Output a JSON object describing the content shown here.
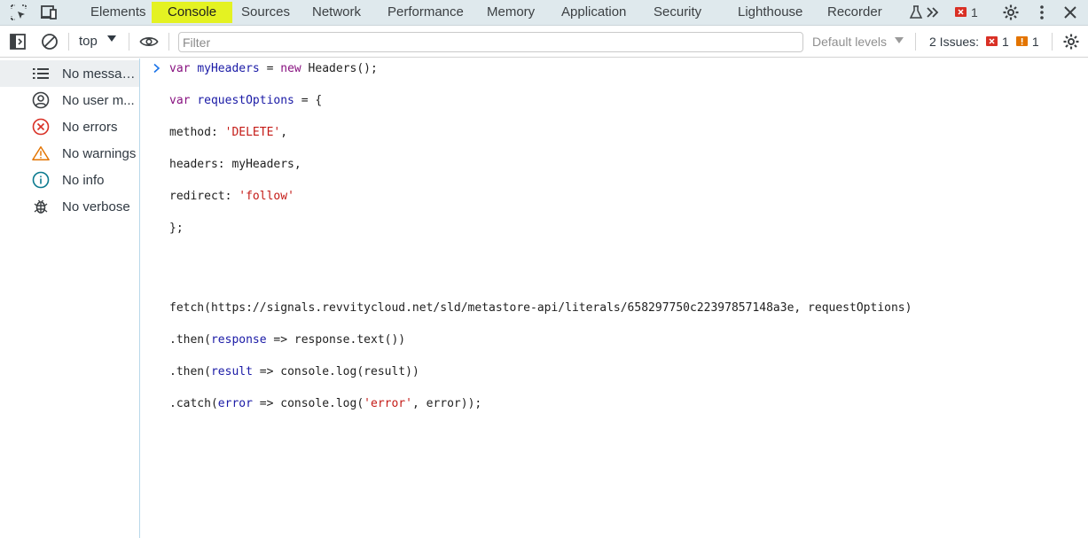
{
  "tabs": {
    "elements": "Elements",
    "console": "Console",
    "sources": "Sources",
    "network": "Network",
    "performance": "Performance",
    "memory": "Memory",
    "application": "Application",
    "security": "Security",
    "lighthouse": "Lighthouse",
    "recorder": "Recorder",
    "active": "Console",
    "error_count": "1"
  },
  "toolbar": {
    "context": "top",
    "filter_placeholder": "Filter",
    "default_levels": "Default levels",
    "issues_label": "2 Issues:",
    "issues_error_count": "1",
    "issues_warning_count": "1"
  },
  "sidebar": {
    "items": [
      {
        "label": "No messag...",
        "icon": "list-icon"
      },
      {
        "label": "No user m...",
        "icon": "user-icon"
      },
      {
        "label": "No errors",
        "icon": "error-icon"
      },
      {
        "label": "No warnings",
        "icon": "warning-icon"
      },
      {
        "label": "No info",
        "icon": "info-icon"
      },
      {
        "label": "No verbose",
        "icon": "bug-icon"
      }
    ]
  },
  "console": {
    "lines": [
      {
        "parts": [
          [
            "kw",
            "var"
          ],
          [
            "plain",
            " "
          ],
          [
            "var",
            "myHeaders"
          ],
          [
            "plain",
            " = "
          ],
          [
            "kw",
            "new"
          ],
          [
            "plain",
            " Headers();"
          ]
        ]
      },
      {
        "parts": [
          [
            "kw",
            "var"
          ],
          [
            "plain",
            " "
          ],
          [
            "var",
            "requestOptions"
          ],
          [
            "plain",
            " = {"
          ]
        ]
      },
      {
        "parts": [
          [
            "plain",
            "method: "
          ],
          [
            "str",
            "'DELETE'"
          ],
          [
            "plain",
            ","
          ]
        ]
      },
      {
        "parts": [
          [
            "plain",
            "headers: myHeaders,"
          ]
        ]
      },
      {
        "parts": [
          [
            "plain",
            "redirect: "
          ],
          [
            "str",
            "'follow'"
          ]
        ]
      },
      {
        "parts": [
          [
            "plain",
            "};"
          ]
        ]
      },
      {
        "parts": [
          [
            "plain",
            "fetch(https://signals.revvitycloud.net/sld/metastore-api/literals/658297750c22397857148a3e, requestOptions)"
          ]
        ]
      },
      {
        "parts": [
          [
            "plain",
            ".then("
          ],
          [
            "var",
            "response"
          ],
          [
            "plain",
            " => response.text())"
          ]
        ]
      },
      {
        "parts": [
          [
            "plain",
            ".then("
          ],
          [
            "var",
            "result"
          ],
          [
            "plain",
            " => console.log(result))"
          ]
        ]
      },
      {
        "parts": [
          [
            "plain",
            ".catch("
          ],
          [
            "var",
            "error"
          ],
          [
            "plain",
            " => console.log("
          ],
          [
            "str",
            "'error'"
          ],
          [
            "plain",
            ", error));"
          ]
        ]
      }
    ]
  },
  "colors": {
    "tabbar_bg": "#dfe9ed",
    "active_tab_highlight": "#e4f222",
    "error_red": "#d93025",
    "warning_orange": "#e37400",
    "info_teal": "#0b7a8f",
    "keyword": "#881280",
    "string": "#c41a16"
  }
}
